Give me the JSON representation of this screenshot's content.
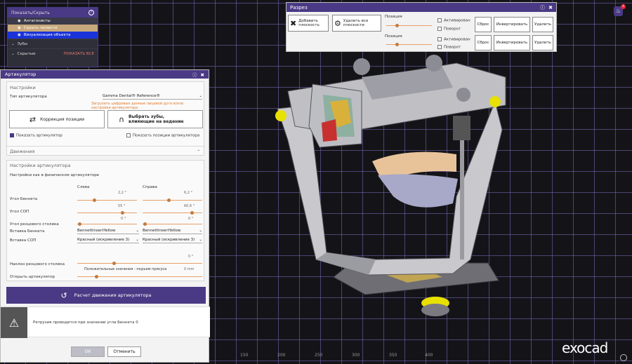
{
  "show_hide": {
    "title": "Показать/Скрыть",
    "items": [
      "Антагонисты",
      "Скрыть челюсти",
      "Визуализация объекта"
    ],
    "rows": [
      {
        "label": "Зубы"
      },
      {
        "label": "Скрытые",
        "action": "ПОКАЗАТЬ ВСЕ"
      }
    ]
  },
  "articulator": {
    "title": "Артикулятор",
    "settings_header": "Настройки",
    "type_label": "Тип артикулятора",
    "type_value": "Gamma Dental® Reference®",
    "warning_link": "Загрузить цифровые данные лицевой дуги и/или настройки артикулятора",
    "correction_button": "Коррекция позиции",
    "select_teeth_button": "Выбрать зубы, влияющие на ведение",
    "show_articulator": "Показать артикулятор",
    "show_positions": "Показать позиции артикулятора",
    "movements_header": "Движения",
    "articulator_settings_header": "Настройки артикулятора",
    "physical_settings": "Настройки как в физическом артикуляторе",
    "left_label": "Слева",
    "right_label": "Справа",
    "params": {
      "bennett": {
        "label": "Угол Беннета",
        "left": "2,2 °",
        "right": "6,2 °"
      },
      "sop": {
        "label": "Угол СОП",
        "left": "55 °",
        "right": "60,6 °"
      },
      "incisal": {
        "label": "Угол резцового столика",
        "left": "0 °",
        "right": "0 °"
      },
      "bennett_insert": {
        "label": "Вставка Беннета",
        "left": "BennettInsertYellow",
        "right": "BennettInsertYellow"
      },
      "sop_insert": {
        "label": "Вставка СОП",
        "left": "Красный (искривление 3)",
        "right": "Красный (искривление 3)"
      }
    },
    "incline": {
      "label": "Наклон резцового столика",
      "value": "0 °"
    },
    "hint": "Положительные значения - подъем присуса",
    "open": {
      "label": "Открыть артикулятор",
      "value": "0 mm"
    },
    "calc_button": "Расчет движения артикулятора",
    "notice": "Ретрузия проводится при значении угла Беннета 0",
    "ok": "ОК",
    "cancel": "Отменить"
  },
  "section": {
    "title": "Разрез",
    "add_plane": "Добавить плоскость",
    "delete_planes": "Удалить все плоскости",
    "position_label": "Позиция",
    "activated": "Активирован",
    "rotation": "Поворот",
    "reset": "Сброс",
    "invert": "Инвертировать",
    "delete": "Удалить"
  },
  "ruler_ticks": [
    "150",
    "200",
    "250",
    "300",
    "350",
    "400"
  ],
  "brand": "exocad",
  "notification_count": "4",
  "colors": {
    "accent": "#4a3a85",
    "link": "#e07a2a"
  }
}
